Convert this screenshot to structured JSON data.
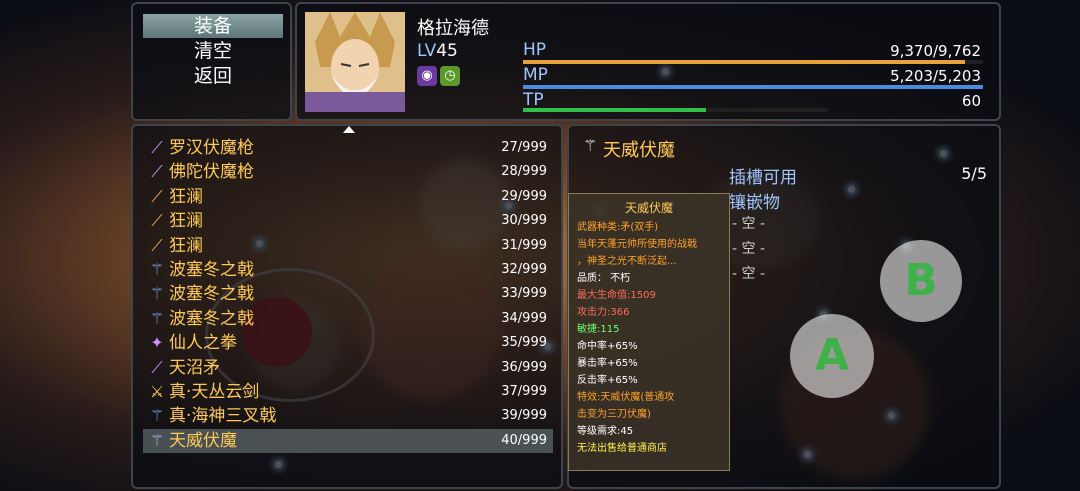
{
  "menu": {
    "items": [
      "装备",
      "清空",
      "返回"
    ],
    "selected_index": 0
  },
  "actor": {
    "name": "格拉海德",
    "level_prefix": "LV",
    "level": "45",
    "hp": {
      "label": "HP",
      "value": "9,370/9,762",
      "ratio": 0.96,
      "color": "#e8a23a"
    },
    "mp": {
      "label": "MP",
      "value": "5,203/5,203",
      "ratio": 1.0,
      "color": "#4a8ae0"
    },
    "tp": {
      "label": "TP",
      "value": "60",
      "ratio": 0.6,
      "color": "#2fbf4a"
    }
  },
  "items": [
    {
      "name": "罗汉伏魔枪",
      "count": "27/999",
      "icon": "spear-icon"
    },
    {
      "name": "佛陀伏魔枪",
      "count": "28/999",
      "icon": "spear-icon"
    },
    {
      "name": "狂澜",
      "count": "29/999",
      "icon": "staff-icon"
    },
    {
      "name": "狂澜",
      "count": "30/999",
      "icon": "staff-icon"
    },
    {
      "name": "狂澜",
      "count": "31/999",
      "icon": "staff-icon"
    },
    {
      "name": "波塞冬之戟",
      "count": "32/999",
      "icon": "trident-icon"
    },
    {
      "name": "波塞冬之戟",
      "count": "33/999",
      "icon": "trident-icon"
    },
    {
      "name": "波塞冬之戟",
      "count": "34/999",
      "icon": "trident-icon"
    },
    {
      "name": "仙人之拳",
      "count": "35/999",
      "icon": "claw-icon"
    },
    {
      "name": "天沼矛",
      "count": "36/999",
      "icon": "spear-icon"
    },
    {
      "name": "真·天丛云剑",
      "count": "37/999",
      "icon": "sword-icon"
    },
    {
      "name": "真·海神三叉戟",
      "count": "39/999",
      "icon": "trident-icon"
    },
    {
      "name": "天威伏魔",
      "count": "40/999",
      "icon": "halberd-icon"
    }
  ],
  "selected_item_index": 12,
  "detail": {
    "title": "天威伏魔",
    "slots_label": "插槽可用",
    "slots_count": "5/5",
    "gems_label": "镶嵌物",
    "empty_slots": [
      "- 空 -",
      "- 空 -",
      "- 空 -"
    ]
  },
  "tooltip": {
    "title": "天威伏魔",
    "lines": [
      {
        "text": "武器种类:矛(双手)",
        "color": "o"
      },
      {
        "text": "当年天蓬元帅所使用的战戟",
        "color": "o"
      },
      {
        "text": "，神圣之光不断泛起...",
        "color": "o"
      },
      {
        "text": "品质：  不朽",
        "color": "w"
      },
      {
        "text": "最大生命值:1509",
        "color": "r"
      },
      {
        "text": "攻击力:366",
        "color": "r"
      },
      {
        "text": "敏捷:115",
        "color": "g"
      },
      {
        "text": "命中率+65%",
        "color": "w"
      },
      {
        "text": "暴击率+65%",
        "color": "w"
      },
      {
        "text": "反击率+65%",
        "color": "w"
      },
      {
        "text": "特效:天威伏魔(普通攻",
        "color": "o"
      },
      {
        "text": "击变为三刀伏魔)",
        "color": "o"
      },
      {
        "text": "等级需求:45",
        "color": "w"
      },
      {
        "text": "无法出售给普通商店",
        "color": "y"
      }
    ]
  },
  "controls": {
    "a_label": "A",
    "b_label": "B"
  }
}
